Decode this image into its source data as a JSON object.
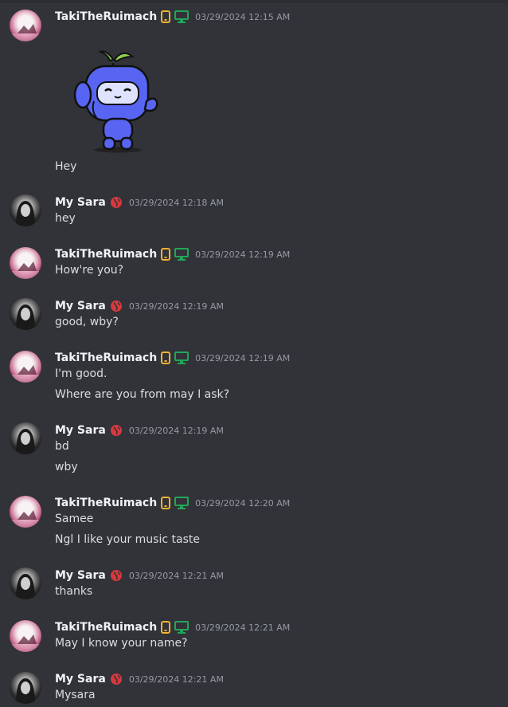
{
  "users": {
    "taki": "TakiTheRuimach",
    "sara": "My Sara"
  },
  "colors": {
    "background": "#313338",
    "username": "#f2f3f5",
    "text": "#dbdee1",
    "timestamp": "#949ba4",
    "phone_badge": "#f0b232",
    "desktop_badge": "#23a559",
    "globe_badge": "#da373c",
    "sticker_body": "#5865f2"
  },
  "icons": {
    "taki_badges": [
      "phone-icon",
      "desktop-icon"
    ],
    "sara_badges": [
      "globe-icon"
    ],
    "sticker": "wumpus-sticker"
  },
  "messages": [
    {
      "author": "TakiTheRuimach",
      "timestamp": "03/29/2024 12:15 AM",
      "has_sticker": true,
      "lines": [
        "Hey"
      ]
    },
    {
      "author": "My Sara",
      "timestamp": "03/29/2024 12:18 AM",
      "lines": [
        "hey"
      ]
    },
    {
      "author": "TakiTheRuimach",
      "timestamp": "03/29/2024 12:19 AM",
      "lines": [
        "How're you?"
      ]
    },
    {
      "author": "My Sara",
      "timestamp": "03/29/2024 12:19 AM",
      "lines": [
        "good, wby?"
      ]
    },
    {
      "author": "TakiTheRuimach",
      "timestamp": "03/29/2024 12:19 AM",
      "lines": [
        "I'm good.",
        "Where are you from may I ask?"
      ]
    },
    {
      "author": "My Sara",
      "timestamp": "03/29/2024 12:19 AM",
      "lines": [
        "bd",
        "wby"
      ]
    },
    {
      "author": "TakiTheRuimach",
      "timestamp": "03/29/2024 12:20 AM",
      "lines": [
        "Samee",
        "Ngl I like your music taste"
      ]
    },
    {
      "author": "My Sara",
      "timestamp": "03/29/2024 12:21 AM",
      "lines": [
        "thanks"
      ]
    },
    {
      "author": "TakiTheRuimach",
      "timestamp": "03/29/2024 12:21 AM",
      "lines": [
        "May I know your name?"
      ]
    },
    {
      "author": "My Sara",
      "timestamp": "03/29/2024 12:21 AM",
      "lines": [
        "Mysara"
      ]
    }
  ]
}
